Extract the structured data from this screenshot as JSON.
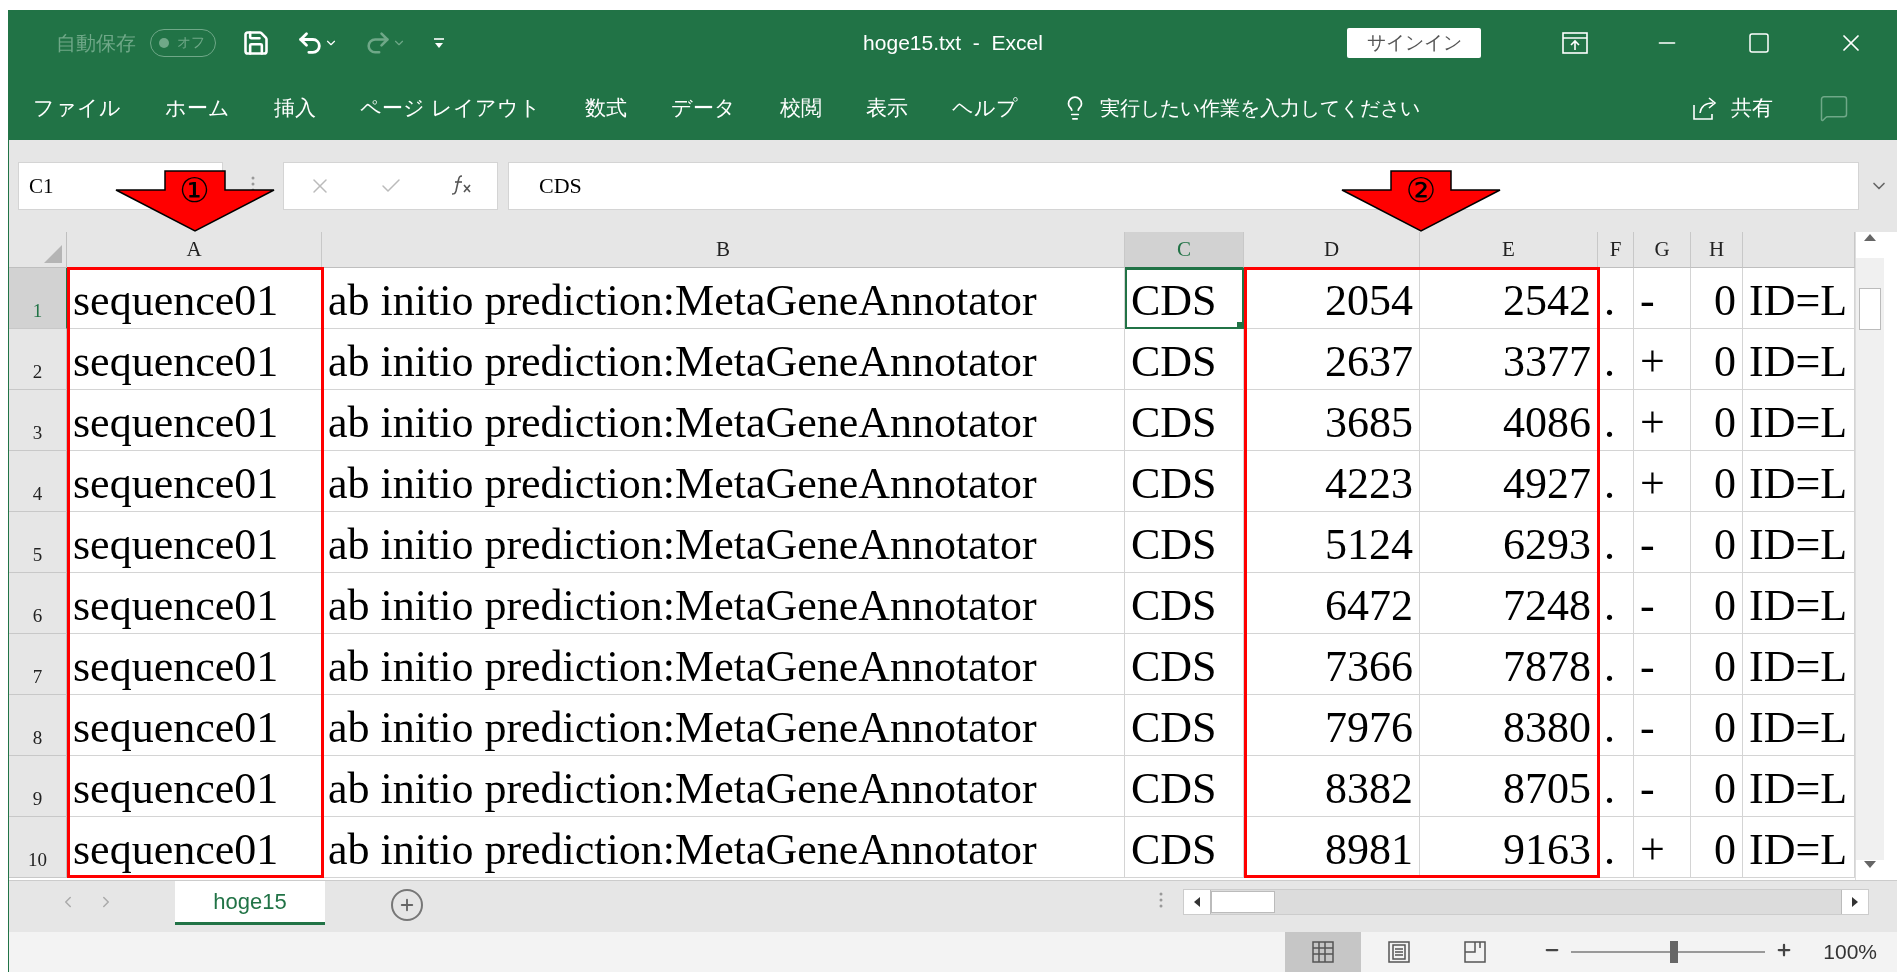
{
  "title_bar": {
    "autosave_label": "自動保存",
    "autosave_toggle": {
      "label": "オフ",
      "on": false
    },
    "title": "hoge15.txt  -  Excel",
    "sign_in": "サインイン"
  },
  "ribbon_tabs": [
    {
      "label": "ファイル"
    },
    {
      "label": "ホーム"
    },
    {
      "label": "挿入"
    },
    {
      "label": "ページ レイアウト"
    },
    {
      "label": "数式"
    },
    {
      "label": "データ"
    },
    {
      "label": "校閲"
    },
    {
      "label": "表示"
    },
    {
      "label": "ヘルプ"
    }
  ],
  "tell_me": {
    "placeholder": "実行したい作業を入力してください"
  },
  "share": "共有",
  "formula_bar": {
    "name_box": "C1",
    "value": "CDS"
  },
  "columns": [
    {
      "label": "A",
      "selected": false,
      "highlighted": true,
      "kind": "text"
    },
    {
      "label": "B",
      "selected": false,
      "highlighted": false,
      "kind": "text"
    },
    {
      "label": "C",
      "selected": true,
      "highlighted": false,
      "kind": "text"
    },
    {
      "label": "D",
      "selected": false,
      "highlighted": true,
      "kind": "number"
    },
    {
      "label": "E",
      "selected": false,
      "highlighted": true,
      "kind": "number"
    },
    {
      "label": "F",
      "selected": false,
      "highlighted": false,
      "kind": "text"
    },
    {
      "label": "G",
      "selected": false,
      "highlighted": false,
      "kind": "text"
    },
    {
      "label": "H",
      "selected": false,
      "highlighted": false,
      "kind": "number"
    },
    {
      "selected": false,
      "highlighted": false,
      "kind": "text"
    }
  ],
  "rows": [
    {
      "number": "1",
      "selected": true,
      "cells": [
        "sequence01",
        "ab initio prediction:MetaGeneAnnotator",
        "CDS",
        "2054",
        "2542",
        ".",
        "-",
        "0",
        "ID=L"
      ]
    },
    {
      "number": "2",
      "selected": false,
      "cells": [
        "sequence01",
        "ab initio prediction:MetaGeneAnnotator",
        "CDS",
        "2637",
        "3377",
        ".",
        "+",
        "0",
        "ID=L"
      ]
    },
    {
      "number": "3",
      "selected": false,
      "cells": [
        "sequence01",
        "ab initio prediction:MetaGeneAnnotator",
        "CDS",
        "3685",
        "4086",
        ".",
        "+",
        "0",
        "ID=L"
      ]
    },
    {
      "number": "4",
      "selected": false,
      "cells": [
        "sequence01",
        "ab initio prediction:MetaGeneAnnotator",
        "CDS",
        "4223",
        "4927",
        ".",
        "+",
        "0",
        "ID=L"
      ]
    },
    {
      "number": "5",
      "selected": false,
      "cells": [
        "sequence01",
        "ab initio prediction:MetaGeneAnnotator",
        "CDS",
        "5124",
        "6293",
        ".",
        "-",
        "0",
        "ID=L"
      ]
    },
    {
      "number": "6",
      "selected": false,
      "cells": [
        "sequence01",
        "ab initio prediction:MetaGeneAnnotator",
        "CDS",
        "6472",
        "7248",
        ".",
        "-",
        "0",
        "ID=L"
      ]
    },
    {
      "number": "7",
      "selected": false,
      "cells": [
        "sequence01",
        "ab initio prediction:MetaGeneAnnotator",
        "CDS",
        "7366",
        "7878",
        ".",
        "-",
        "0",
        "ID=L"
      ]
    },
    {
      "number": "8",
      "selected": false,
      "cells": [
        "sequence01",
        "ab initio prediction:MetaGeneAnnotator",
        "CDS",
        "7976",
        "8380",
        ".",
        "-",
        "0",
        "ID=L"
      ]
    },
    {
      "number": "9",
      "selected": false,
      "cells": [
        "sequence01",
        "ab initio prediction:MetaGeneAnnotator",
        "CDS",
        "8382",
        "8705",
        ".",
        "-",
        "0",
        "ID=L"
      ]
    },
    {
      "number": "10",
      "selected": false,
      "cells": [
        "sequence01",
        "ab initio prediction:MetaGeneAnnotator",
        "CDS",
        "8981",
        "9163",
        ".",
        "+",
        "0",
        "ID=L"
      ]
    }
  ],
  "annotations": [
    {
      "label": "①"
    },
    {
      "label": "②"
    }
  ],
  "sheet_tabs": [
    {
      "label": "hoge15",
      "selected": true
    }
  ],
  "status_bar": {
    "view_modes": [
      {
        "kind": "normal",
        "selected": true
      },
      {
        "kind": "page_layout",
        "selected": false
      },
      {
        "kind": "page_break",
        "selected": false
      }
    ],
    "zoom_slider": {
      "level": 0.53
    },
    "zoom": "100%"
  }
}
